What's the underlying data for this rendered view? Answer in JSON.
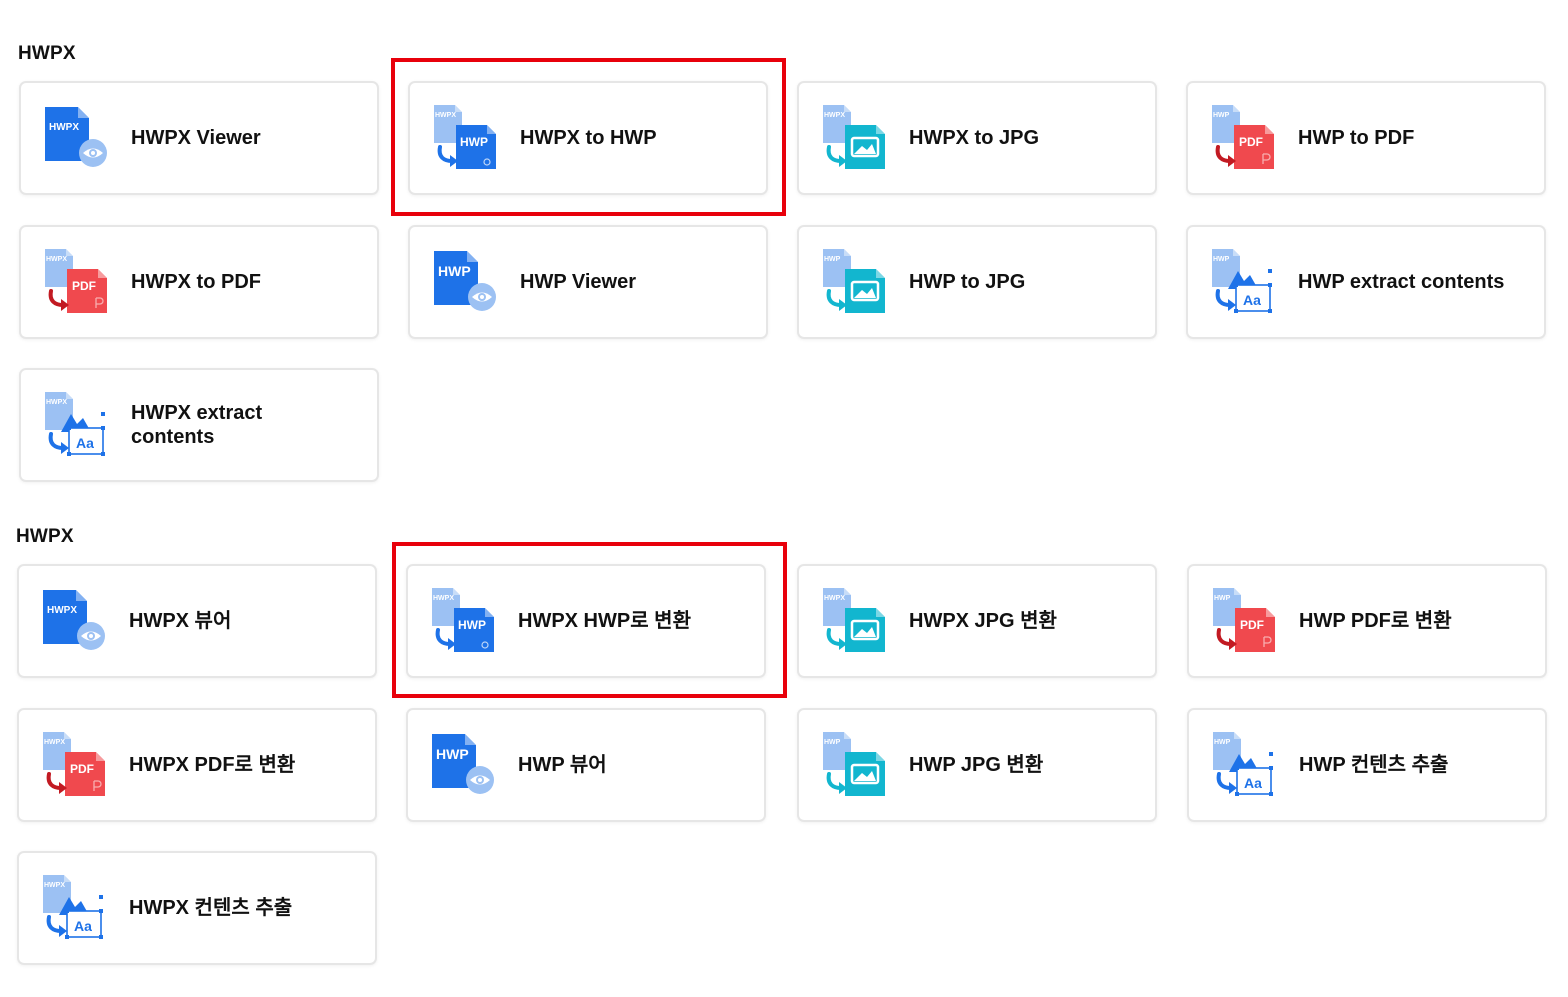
{
  "sections": [
    {
      "title": "HWPX",
      "cards": [
        {
          "label": "HWPX Viewer",
          "icon": "hwpx-viewer-icon"
        },
        {
          "label": "HWPX to HWP",
          "icon": "hwpx-to-hwp-icon"
        },
        {
          "label": "HWPX to JPG",
          "icon": "hwpx-to-jpg-icon"
        },
        {
          "label": "HWP to PDF",
          "icon": "hwp-to-pdf-icon"
        },
        {
          "label": "HWPX to PDF",
          "icon": "hwpx-to-pdf-icon"
        },
        {
          "label": "HWP Viewer",
          "icon": "hwp-viewer-icon"
        },
        {
          "label": "HWP to JPG",
          "icon": "hwp-to-jpg-icon"
        },
        {
          "label": "HWP extract contents",
          "icon": "hwp-extract-icon"
        },
        {
          "label": "HWPX extract contents",
          "icon": "hwpx-extract-icon"
        }
      ]
    },
    {
      "title": "HWPX",
      "cards": [
        {
          "label": "HWPX 뷰어",
          "icon": "hwpx-viewer-icon"
        },
        {
          "label": "HWPX HWP로 변환",
          "icon": "hwpx-to-hwp-icon"
        },
        {
          "label": "HWPX JPG 변환",
          "icon": "hwpx-to-jpg-icon"
        },
        {
          "label": "HWP PDF로 변환",
          "icon": "hwp-to-pdf-icon"
        },
        {
          "label": "HWPX PDF로 변환",
          "icon": "hwpx-to-pdf-icon"
        },
        {
          "label": "HWP 뷰어",
          "icon": "hwp-viewer-icon"
        },
        {
          "label": "HWP JPG 변환",
          "icon": "hwp-to-jpg-icon"
        },
        {
          "label": "HWP 컨텐츠 추출",
          "icon": "hwp-extract-icon"
        },
        {
          "label": "HWPX 컨텐츠 추출",
          "icon": "hwpx-extract-icon"
        }
      ]
    }
  ],
  "icon_text": {
    "hwpx": "HWPX",
    "hwp": "HWP",
    "pdf": "PDF",
    "aa": "Aa"
  },
  "colors": {
    "blue": "#1e72e8",
    "light_blue": "#9cc1f3",
    "teal": "#12b6cf",
    "red_pdf": "#f0494e",
    "arrow_red": "#c21a22",
    "highlight": "#e8000b",
    "card_border": "#e6e6e6"
  }
}
